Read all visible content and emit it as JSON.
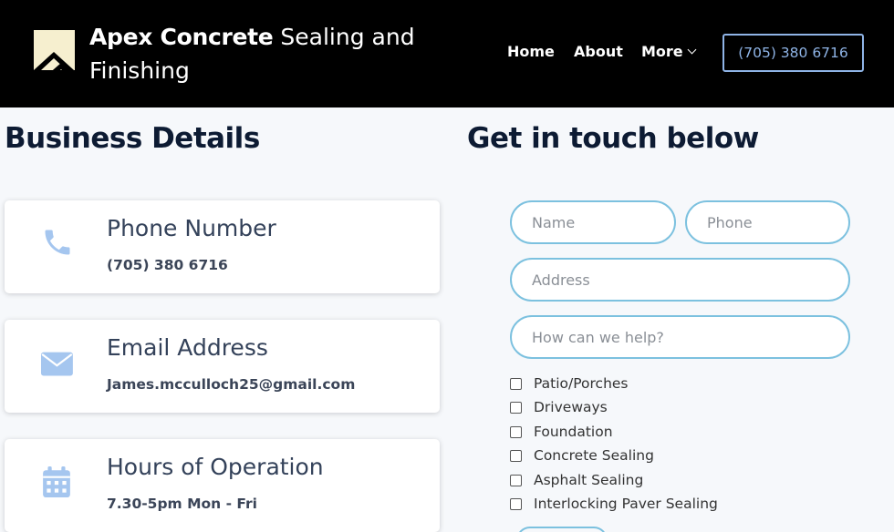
{
  "header": {
    "brand_bold": "Apex Concrete",
    "brand_rest": " Sealing and Finishing",
    "nav": {
      "home": "Home",
      "about": "About",
      "more": "More"
    },
    "phone_button": "(705) 380 6716",
    "logo_icon": "apex-logo-icon"
  },
  "business": {
    "heading": "Business Details",
    "cards": [
      {
        "icon": "phone-icon",
        "title": "Phone Number",
        "value": "(705) 380 6716"
      },
      {
        "icon": "envelope-icon",
        "title": "Email Address",
        "value": "James.mcculloch25@gmail.com"
      },
      {
        "icon": "calendar-icon",
        "title": "Hours of Operation",
        "value": "7.30-5pm Mon - Fri"
      }
    ]
  },
  "contact": {
    "heading": "Get in touch below",
    "name_placeholder": "Name",
    "phone_placeholder": "Phone",
    "address_placeholder": "Address",
    "help_placeholder": "How can we help?",
    "options": [
      "Patio/Porches",
      "Driveways",
      "Foundation",
      "Concrete Sealing",
      "Asphalt Sealing",
      "Interlocking Paver Sealing"
    ]
  },
  "colors": {
    "header_bg": "#000000",
    "accent_blue": "#8fb4e6",
    "field_border": "#7cc1df",
    "icon_blue": "#a5c6ef"
  }
}
